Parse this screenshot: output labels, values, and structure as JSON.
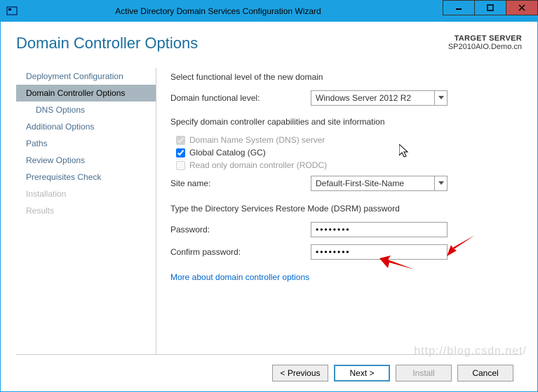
{
  "titlebar": {
    "title": "Active Directory Domain Services Configuration Wizard"
  },
  "header": {
    "heading": "Domain Controller Options",
    "target_label": "TARGET SERVER",
    "target_value": "SP2010AIO.Demo.cn"
  },
  "sidebar": {
    "items": [
      {
        "label": "Deployment Configuration",
        "state": "normal"
      },
      {
        "label": "Domain Controller Options",
        "state": "selected"
      },
      {
        "label": "DNS Options",
        "state": "sub"
      },
      {
        "label": "Additional Options",
        "state": "normal"
      },
      {
        "label": "Paths",
        "state": "normal"
      },
      {
        "label": "Review Options",
        "state": "normal"
      },
      {
        "label": "Prerequisites Check",
        "state": "normal"
      },
      {
        "label": "Installation",
        "state": "disabled"
      },
      {
        "label": "Results",
        "state": "disabled"
      }
    ]
  },
  "content": {
    "func_level_title": "Select functional level of the new domain",
    "func_level_label": "Domain functional level:",
    "func_level_value": "Windows Server 2012 R2",
    "caps_title": "Specify domain controller capabilities and site information",
    "dns_checkbox": "Domain Name System (DNS) server",
    "gc_checkbox": "Global Catalog (GC)",
    "rodc_checkbox": "Read only domain controller (RODC)",
    "site_label": "Site name:",
    "site_value": "Default-First-Site-Name",
    "dsrm_title": "Type the Directory Services Restore Mode (DSRM) password",
    "pw_label": "Password:",
    "pw_value": "••••••••",
    "cpw_label": "Confirm password:",
    "cpw_value": "••••••••",
    "link": "More about domain controller options"
  },
  "footer": {
    "prev": "< Previous",
    "next": "Next >",
    "install": "Install",
    "cancel": "Cancel"
  },
  "watermark": "http://blog.csdn.net/"
}
